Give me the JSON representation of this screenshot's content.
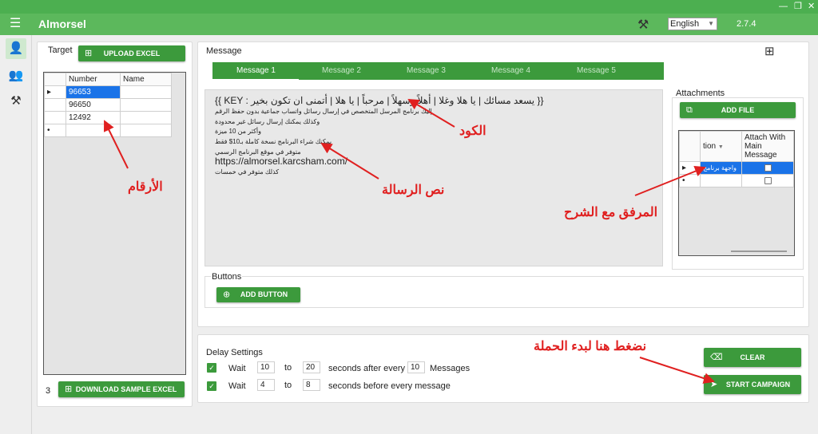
{
  "window": {
    "minimize": "—",
    "restore": "❐",
    "close": "✕"
  },
  "appbar": {
    "menu_icon": "☰",
    "title": "Almorsel",
    "tools_icon": "⚒",
    "language": "English",
    "version": "2.7.4"
  },
  "nav": {
    "user_icon": "👤",
    "group_icon": "👥",
    "tools_icon": "⚒"
  },
  "target": {
    "label": "Target",
    "upload_label": "UPLOAD EXCEL",
    "columns": [
      "Number",
      "Name"
    ],
    "rows": [
      {
        "marker": "▸",
        "number": "96653",
        "name": ""
      },
      {
        "marker": "",
        "number": "96650",
        "name": ""
      },
      {
        "marker": "",
        "number": "12492",
        "name": ""
      },
      {
        "marker": "•",
        "number": "",
        "name": ""
      }
    ],
    "count": "3",
    "download_label": "DOWNLOAD SAMPLE EXCEL"
  },
  "message": {
    "label": "Message",
    "add_icon": "⊞",
    "tabs": [
      "Message 1",
      "Message 2",
      "Message 3",
      "Message 4",
      "Message 5"
    ],
    "lines": [
      "{{ KEY : يسعد مسائك | يا هلا وغلا | أهلاً وسهلاً | مرحباً | يا هلا | أتمنى ان تكون بخير }}",
      "إليك برنامج المرسل المتخصص في إرسال رسائل واتساب جماعية بدون حفظ الرقم",
      "وكذلك يمكنك إرسال رسائل غير محدودة",
      "وأكثر من 10 ميزة",
      "يمكنك شراء البرنامج نسخة كاملة بـ10$ فقط",
      "متوفر في موقع البرنامج الرسمي",
      "https://almorsel.karcsham.com/",
      "كذلك متوفر في خمسات"
    ]
  },
  "attachments": {
    "label": "Attachments",
    "add_label": "ADD FILE",
    "col_title": "tion",
    "col_attach": "Attach With Main Message",
    "rows": [
      {
        "marker": "▸",
        "title": "واجهة برنامج"
      },
      {
        "marker": "•",
        "title": ""
      }
    ]
  },
  "buttons": {
    "label": "Buttons",
    "add_label": "ADD BUTTON"
  },
  "delay": {
    "label": "Delay Settings",
    "row1": {
      "wait": "Wait",
      "from": "10",
      "to_label": "to",
      "to": "20",
      "suffix": "seconds after every",
      "every": "10",
      "unit": "Messages"
    },
    "row2": {
      "wait": "Wait",
      "from": "4",
      "to_label": "to",
      "to": "8",
      "suffix": "seconds before every message"
    }
  },
  "actions": {
    "clear_label": "CLEAR",
    "start_label": "START CAMPAIGN"
  },
  "annotations": {
    "numbers": "الأرقام",
    "code": "الكود",
    "message_text": "نص الرسالة",
    "attachment": "المرفق مع الشرح",
    "start_hint": "نضغط هنا لبدء الحملة"
  },
  "colors": {
    "titlebar": "#4caf50",
    "appbar": "#5cb85c",
    "button": "#3c9a3c",
    "selection": "#1a73e8",
    "annotation": "#e02020"
  }
}
